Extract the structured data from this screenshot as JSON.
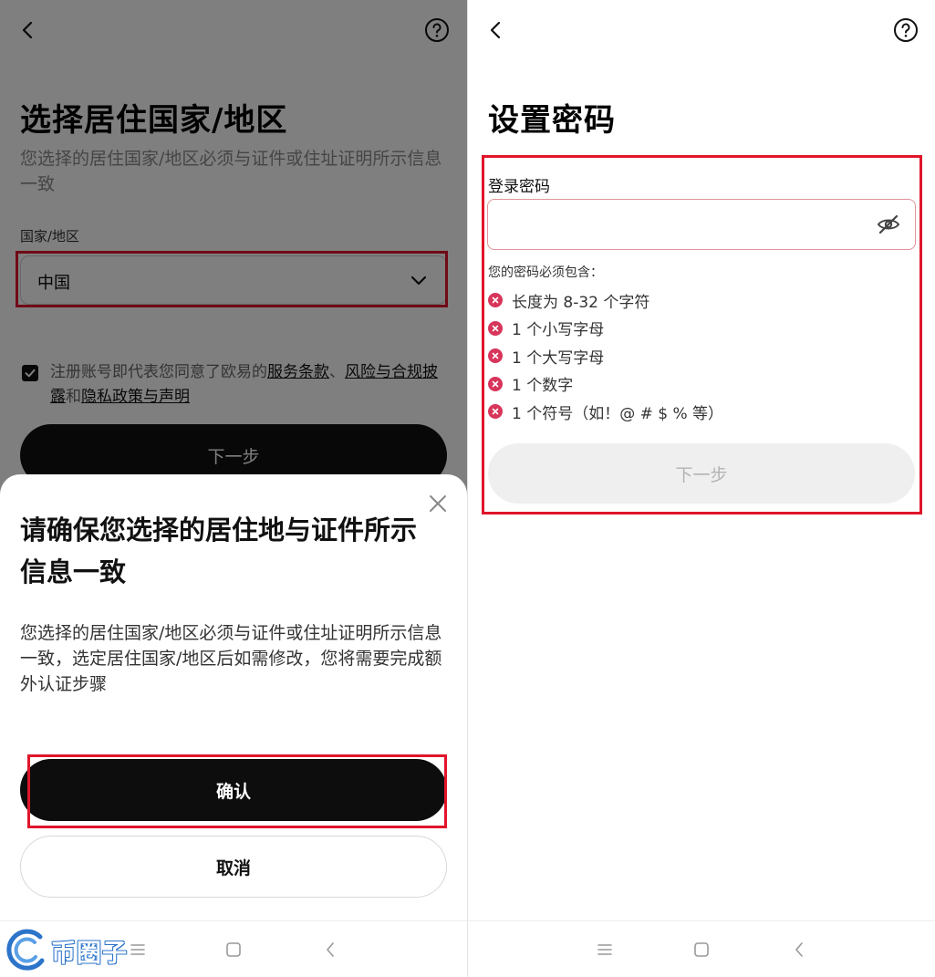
{
  "left": {
    "page": {
      "title": "选择居住国家/地区",
      "subtitle": "您选择的居住国家/地区必须与证件或住址证明所示信息一致",
      "field_label": "国家/地区",
      "selected_country": "中国",
      "terms_prefix": "注册账号即代表您同意了欧易的",
      "terms_link_service": "服务条款",
      "terms_sep": "、",
      "terms_link_risk": "风险与合规披露",
      "terms_and": "和",
      "terms_link_privacy": "隐私政策与声明",
      "checkbox_checked": true,
      "next_label": "下一步"
    },
    "sheet": {
      "title": "请确保您选择的居住地与证件所示信息一致",
      "body": "您选择的居住国家/地区必须与证件或住址证明所示信息一致，选定居住国家/地区后如需修改，您将需要完成额外认证步骤",
      "confirm_label": "确认",
      "cancel_label": "取消"
    }
  },
  "right": {
    "title": "设置密码",
    "field_label": "登录密码",
    "password_value": "",
    "hint": "您的密码必须包含：",
    "rules": [
      "长度为 8-32 个字符",
      "1 个小写字母",
      "1 个大写字母",
      "1 个数字",
      "1 个符号（如！@ # $ % 等）"
    ],
    "next_label": "下一步"
  },
  "watermark": {
    "text": "币圈子"
  },
  "icons": {
    "back": "chevron-left-icon",
    "help": "question-circle-icon",
    "dropdown": "chevron-down-icon",
    "close": "close-icon",
    "eye": "eye-off-icon",
    "rule_fail": "x-circle-icon"
  },
  "colors": {
    "highlight": "#e0152b",
    "primary_button": "#0d0d0d",
    "rule_fail": "#d8355b",
    "disabled_button": "#efefef",
    "disabled_text": "#b3b3b3"
  }
}
